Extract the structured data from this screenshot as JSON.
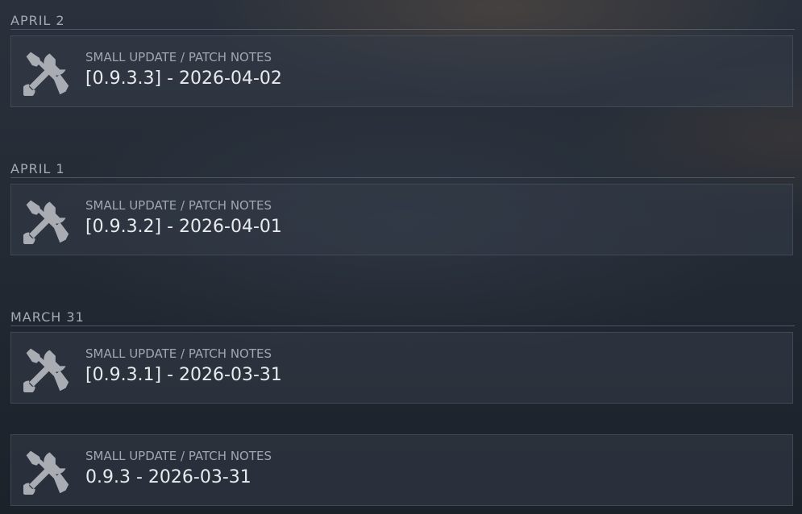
{
  "groups": [
    {
      "date": "APRIL 2",
      "events": [
        {
          "type": "SMALL UPDATE / PATCH NOTES",
          "title": "[0.9.3.3] - 2026-04-02",
          "icon": "tools-icon"
        }
      ]
    },
    {
      "date": "APRIL 1",
      "events": [
        {
          "type": "SMALL UPDATE / PATCH NOTES",
          "title": "[0.9.3.2] - 2026-04-01",
          "icon": "tools-icon"
        }
      ]
    },
    {
      "date": "MARCH 31",
      "events": [
        {
          "type": "SMALL UPDATE / PATCH NOTES",
          "title": "[0.9.3.1] - 2026-03-31",
          "icon": "tools-icon"
        },
        {
          "type": "SMALL UPDATE / PATCH NOTES",
          "title": "0.9.3 - 2026-03-31",
          "icon": "tools-icon"
        }
      ]
    }
  ],
  "colors": {
    "icon": "#a9adb3",
    "label": "#a3abb6",
    "title": "#e8ebee"
  }
}
